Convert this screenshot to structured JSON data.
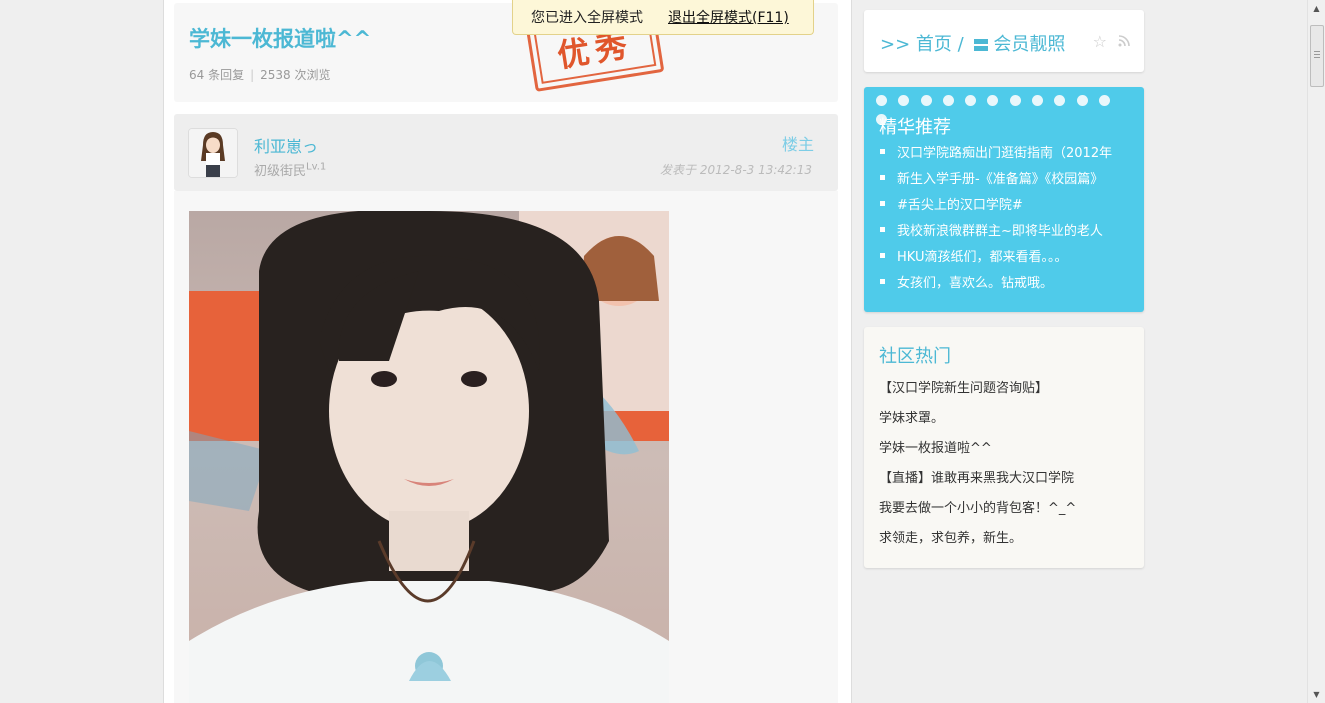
{
  "fullscreen_bar": {
    "message": "您已进入全屏模式",
    "exit_label": "退出全屏模式(F11)"
  },
  "topic": {
    "title": "学妹一枚报道啦^^",
    "replies": "64 条回复",
    "views": "2538 次浏览",
    "stamp": "优秀"
  },
  "post": {
    "author": "利亚崽っ",
    "rank": "初级街民",
    "level": "Lv.1",
    "floor": "楼主",
    "time": "发表于 2012-8-3 13:42:13"
  },
  "breadcrumb": {
    "home": ">> 首页 /",
    "section": "会员靓照"
  },
  "featured": {
    "title": "精华推荐",
    "items": [
      "汉口学院路痴出门逛街指南（2012年",
      "新生入学手册-《准备篇》《校园篇》",
      "#舌尖上的汉口学院#",
      "我校新浪微群群主~即将毕业的老人",
      "HKU滴孩纸们，都来看看。。。",
      "女孩们，喜欢么。钻戒哦。"
    ]
  },
  "hot": {
    "title": "社区热门",
    "items": [
      "【汉口学院新生问题咨询贴】",
      "学妹求罩。",
      "学妹一枚报道啦^^",
      "【直播】谁敢再来黑我大汉口学院",
      "我要去做一个小小的背包客！^_^",
      "求领走，求包养，新生。"
    ]
  },
  "colors": {
    "accent": "#4cb8d4",
    "featured_bg": "#4fcbea",
    "stamp": "#e0562c"
  }
}
